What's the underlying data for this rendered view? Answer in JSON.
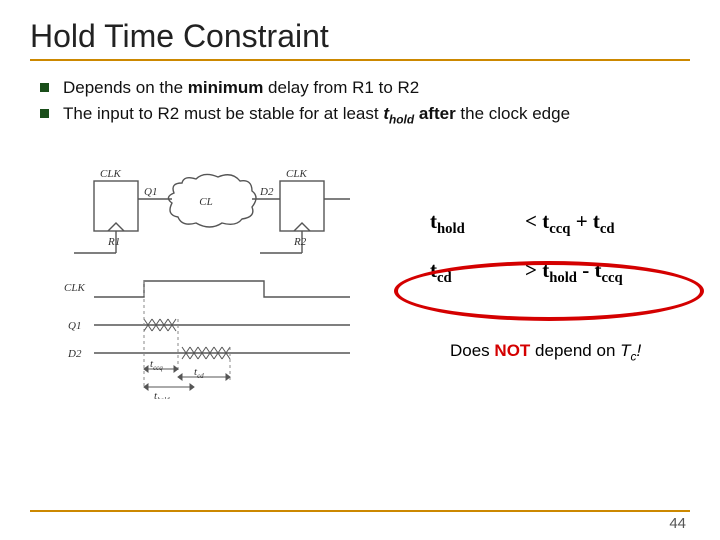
{
  "title": "Hold Time Constraint",
  "bullets": [
    {
      "pre": "Depends on the ",
      "bold": "minimum",
      "post": " delay from R1 to R2"
    },
    {
      "pre": "The input to R2 must be stable for at least ",
      "bolditalic": "t",
      "bolditalic_sub": "hold",
      "bold2": " after",
      "post2": " the clock edge"
    }
  ],
  "circuit": {
    "CLK_left": "CLK",
    "CLK_right": "CLK",
    "Q1": "Q1",
    "D2": "D2",
    "R1": "R1",
    "R2": "R2",
    "CL": "CL",
    "CLK_wave": "CLK",
    "t_ccq": "t",
    "t_ccq_sub": "ccq",
    "t_cd": "t",
    "t_cd_sub": "cd",
    "t_hold": "t",
    "t_hold_sub": "hold"
  },
  "eq": {
    "row1_l": "t",
    "row1_l_sub": "hold",
    "row1_r_pre": "< t",
    "row1_r_sub1": "ccq",
    "row1_r_mid": " + t",
    "row1_r_sub2": "cd",
    "row2_l": "t",
    "row2_l_sub": "cd",
    "row2_r_pre": "> t",
    "row2_r_sub1": "hold",
    "row2_r_mid": " - t",
    "row2_r_sub2": "ccq"
  },
  "note": {
    "pre": "Does ",
    "not": "NOT",
    "mid": " depend on ",
    "var": "T",
    "var_sub": "c",
    "end": "!"
  },
  "page": "44"
}
